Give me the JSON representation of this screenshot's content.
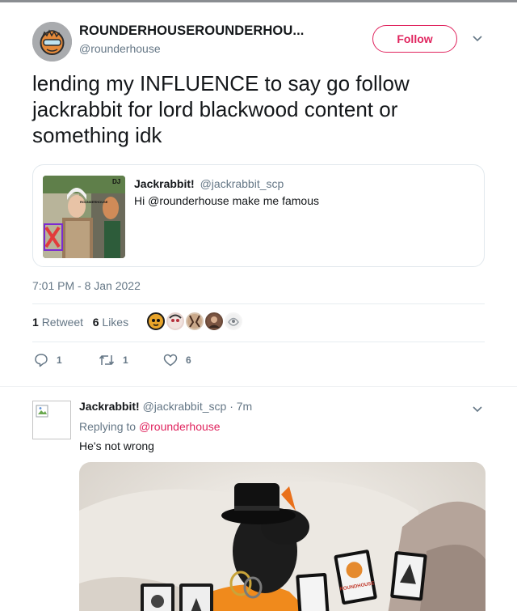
{
  "author": {
    "display_name": "ROUNDERHOUSEROUNDERHOU...",
    "handle": "@rounderhouse",
    "follow_label": "Follow"
  },
  "tweet": {
    "text": "lending my INFLUENCE to say go follow jackrabbit for lord blackwood content or something idk",
    "timestamp": "7:01 PM - 8 Jan 2022",
    "retweet_count": "1",
    "retweet_label": "Retweet",
    "like_count": "6",
    "like_label": "Likes"
  },
  "quoted_tweet": {
    "name": "Jackrabbit!",
    "handle": "@jackrabbit_scp",
    "text": "Hi @rounderhouse make me famous",
    "image_caption_top": "DJ",
    "image_caption_mid": "ROUNDERHOUSE"
  },
  "actions": {
    "reply_count": "1",
    "retweet_count": "1",
    "like_count": "6"
  },
  "reply": {
    "name": "Jackrabbit!",
    "handle": "@jackrabbit_scp",
    "time": "· 7m",
    "replying_prefix": "Replying to",
    "replying_to": "@rounderhouse",
    "text": "He's not wrong",
    "card_text": "ROUNDHOUSE"
  },
  "colors": {
    "accent": "#e0245e",
    "secondary_text": "#657786",
    "divider": "#e6ecf0"
  },
  "icons": [
    "chevron-down-icon",
    "reply-icon",
    "retweet-icon",
    "heart-icon",
    "broken-image-icon"
  ]
}
